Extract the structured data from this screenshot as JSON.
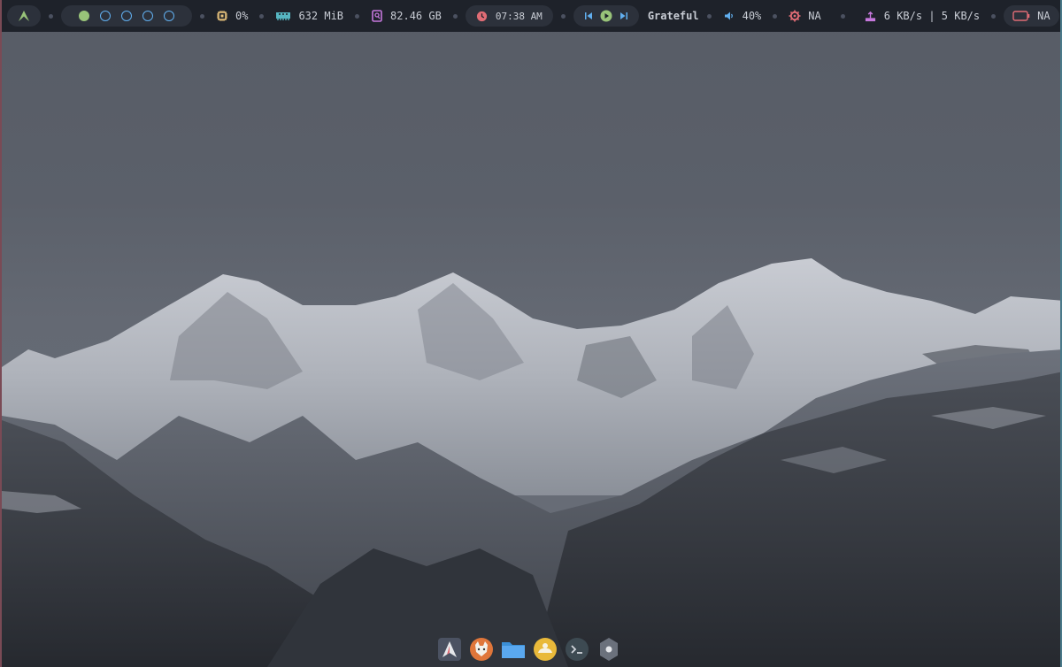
{
  "colors": {
    "bar_bg": "#1e222a",
    "pill_bg": "#2c313b",
    "accent_green": "#98c379",
    "accent_blue": "#61afef",
    "accent_red": "#e06c75",
    "accent_yellow": "#e5c07b",
    "accent_purple": "#c678dd",
    "accent_cyan": "#56b6c2"
  },
  "topbar": {
    "launcher_icon": "arch-logo-icon",
    "workspaces": [
      {
        "state": "active"
      },
      {
        "state": "empty"
      },
      {
        "state": "empty"
      },
      {
        "state": "empty"
      },
      {
        "state": "empty"
      }
    ],
    "cpu": {
      "icon": "cpu-icon",
      "value": "0%"
    },
    "memory": {
      "icon": "ram-icon",
      "value": "632 MiB"
    },
    "disk": {
      "icon": "disk-icon",
      "value": "82.46 GB"
    },
    "clock": {
      "icon": "clock-icon",
      "value": "07:38 AM"
    },
    "media": {
      "prev_icon": "skip-previous-icon",
      "play_icon": "play-icon",
      "next_icon": "skip-next-icon",
      "title": "Grateful"
    },
    "volume": {
      "icon": "speaker-icon",
      "value": "40%"
    },
    "brightness": {
      "icon": "gear-icon",
      "value": "NA"
    },
    "network": {
      "icon": "network-icon",
      "value": "6 KB/s | 5 KB/s"
    },
    "battery": {
      "icon": "battery-icon",
      "value": "NA"
    }
  },
  "dock": {
    "apps": [
      {
        "icon": "arch-logo-icon"
      },
      {
        "icon": "firefox-icon"
      },
      {
        "icon": "folder-icon"
      },
      {
        "icon": "weather-icon"
      },
      {
        "icon": "terminal-icon"
      },
      {
        "icon": "settings-icon"
      }
    ]
  }
}
